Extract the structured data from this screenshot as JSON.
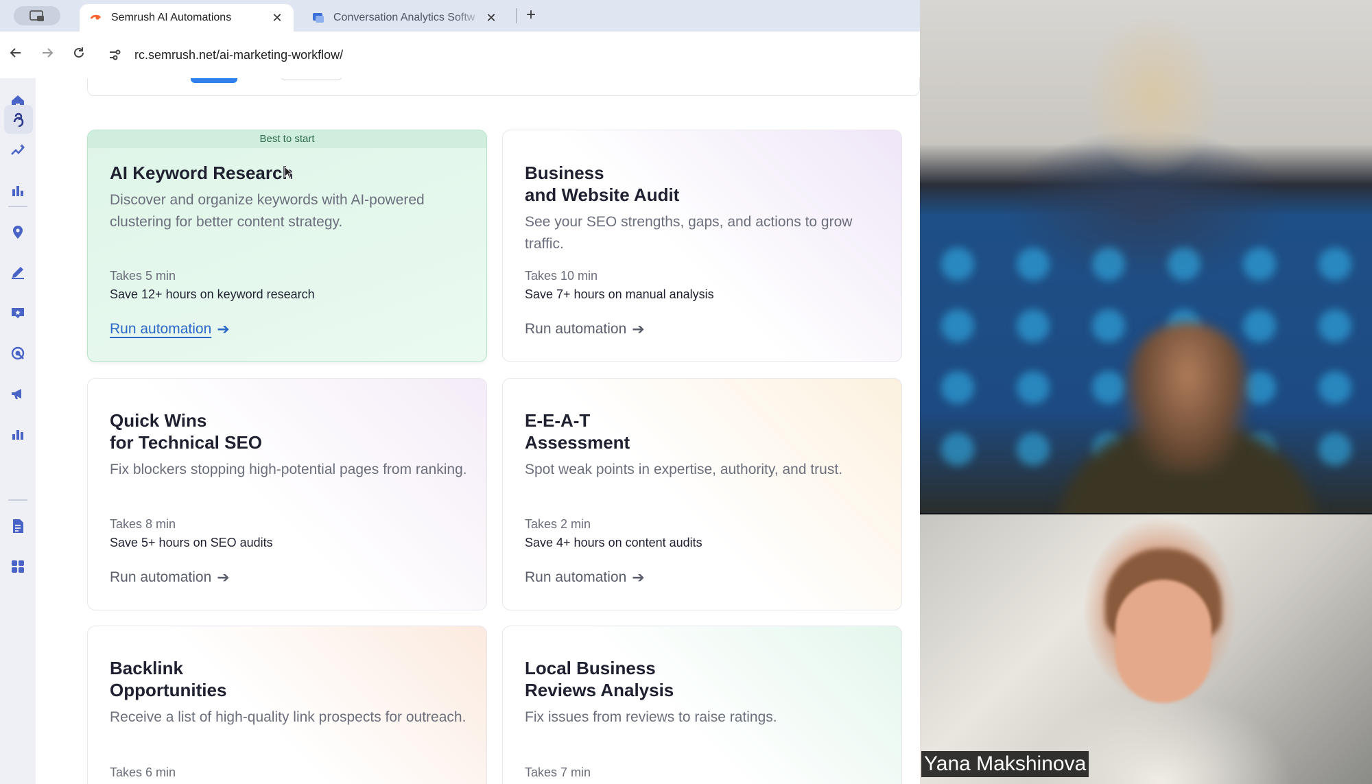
{
  "browser": {
    "tabs": [
      {
        "title": "Semrush AI Automations",
        "active": true
      },
      {
        "title": "Conversation Analytics Softw",
        "active": false
      }
    ],
    "url": "rc.semrush.net/ai-marketing-workflow/"
  },
  "sidebar": {
    "icons": [
      "home-icon",
      "automation-icon",
      "trend-icon",
      "bar-chart-icon",
      "location-pin-icon",
      "edit-icon",
      "review-icon",
      "target-icon",
      "megaphone-icon",
      "stats-icon",
      "document-icon",
      "apps-grid-icon"
    ],
    "active": "automation-icon"
  },
  "cards": [
    {
      "badge": "Best to start",
      "title": "AI Keyword Research",
      "description": "Discover and organize keywords with AI-powered clustering for better content strategy.",
      "takes": "Takes 5 min",
      "save": "Save 12+ hours on keyword research",
      "run_label": "Run automation",
      "arrow": "➔",
      "tint": "#dff5e8"
    },
    {
      "title": "Business\nand Website Audit",
      "description": "See your SEO strengths, gaps, and actions to grow traffic.",
      "takes": "Takes 10 min",
      "save": "Save 7+ hours on manual analysis",
      "run_label": "Run automation",
      "arrow": "➔",
      "tint": "#efe6f7"
    },
    {
      "title": "Quick Wins\nfor Technical SEO",
      "description": "Fix blockers stopping high-potential pages from ranking.",
      "takes": "Takes 8 min",
      "save": "Save 5+ hours on SEO audits",
      "run_label": "Run automation",
      "arrow": "➔",
      "tint": "#f4ecf7"
    },
    {
      "title": "E-E-A-T\nAssessment",
      "description": "Spot weak points in expertise, authority, and trust.",
      "takes": "Takes 2 min",
      "save": "Save 4+ hours on content audits",
      "run_label": "Run automation",
      "arrow": "➔",
      "tint": "#fcf1df"
    },
    {
      "title": "Backlink\nOpportunities",
      "description": "Receive a list of high-quality link prospects for outreach.",
      "takes": "Takes 6 min",
      "tint": "#fbeadf"
    },
    {
      "title": "Local Business\nReviews Analysis",
      "description": "Fix issues from reviews to raise ratings.",
      "takes": "Takes 7 min",
      "tint": "#e3f6ec"
    }
  ],
  "video_call": {
    "participant_name": "Yana Makshinova"
  }
}
